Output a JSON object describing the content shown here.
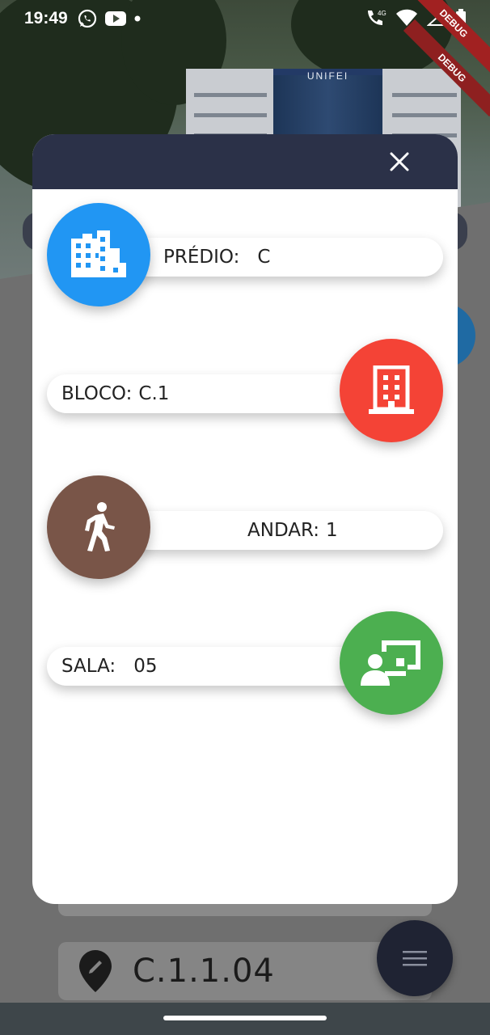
{
  "status_bar": {
    "time": "19:49",
    "left_icons": [
      "whatsapp-icon",
      "youtube-icon",
      "dot-icon"
    ],
    "right_icons": [
      "call-4g-icon",
      "wifi-icon",
      "signal-icon",
      "battery-icon"
    ],
    "debug_label": "DEBUG"
  },
  "background": {
    "building_sign": "UNIFEI",
    "location_code": "C.1.1.04"
  },
  "dialog": {
    "items": [
      {
        "label": "PRÉDIO:",
        "value": "C",
        "icon": "building-icon",
        "color": "#2196f3"
      },
      {
        "label": "BLOCO:",
        "value": "C.1",
        "icon": "office-block-icon",
        "color": "#f44336"
      },
      {
        "label": "ANDAR:",
        "value": "1",
        "icon": "walking-person-icon",
        "color": "#795548"
      },
      {
        "label": "SALA:",
        "value": "05",
        "icon": "classroom-icon",
        "color": "#4caf50"
      }
    ]
  },
  "colors": {
    "dialog_header": "#2b3148",
    "fab_menu": "#1f2333"
  }
}
